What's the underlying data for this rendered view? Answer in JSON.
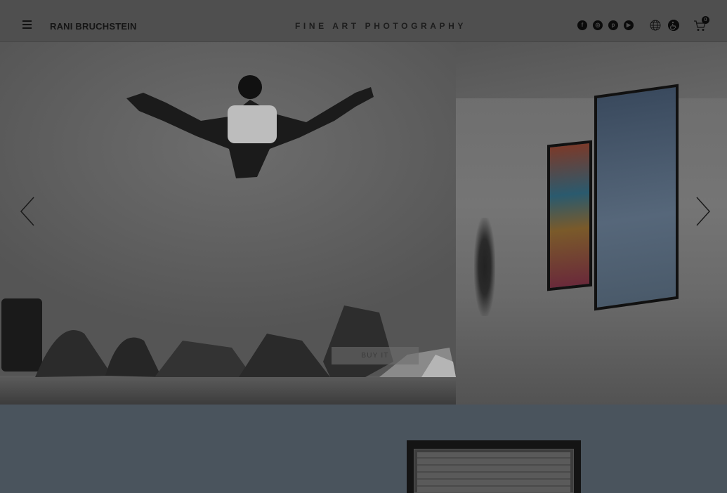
{
  "header": {
    "brand": "RANI BRUCHSTEIN",
    "tagline": "FINE ART PHOTOGRAPHY",
    "social_icons": [
      "facebook-icon",
      "instagram-icon",
      "pinterest-icon",
      "youtube-icon"
    ],
    "social_glyphs": [
      "f",
      "◎",
      "p",
      "▶"
    ],
    "cart_count": "0"
  },
  "hero": {
    "buy_label": "BUY IT"
  },
  "colors": {
    "header_bg": "#4f4f4f",
    "lower_bg": "#4a545d",
    "icon_dark": "#0b0b0b"
  }
}
